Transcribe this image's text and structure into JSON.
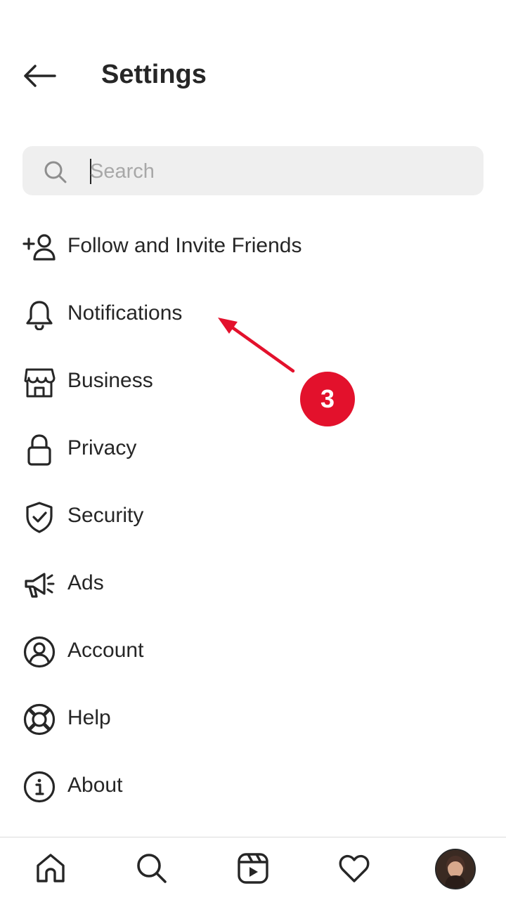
{
  "header": {
    "title": "Settings",
    "back_icon": "arrow-left-icon"
  },
  "search": {
    "placeholder": "Search",
    "value": "",
    "icon": "search-icon"
  },
  "menu": {
    "items": [
      {
        "label": "Follow and Invite Friends",
        "icon": "add-person-icon"
      },
      {
        "label": "Notifications",
        "icon": "bell-icon"
      },
      {
        "label": "Business",
        "icon": "storefront-icon"
      },
      {
        "label": "Privacy",
        "icon": "lock-icon"
      },
      {
        "label": "Security",
        "icon": "shield-check-icon"
      },
      {
        "label": "Ads",
        "icon": "megaphone-icon"
      },
      {
        "label": "Account",
        "icon": "user-circle-icon"
      },
      {
        "label": "Help",
        "icon": "lifebuoy-icon"
      },
      {
        "label": "About",
        "icon": "info-icon"
      }
    ]
  },
  "annotation": {
    "step_number": "3",
    "color": "#e3112c"
  },
  "bottom_nav": {
    "tabs": [
      {
        "icon": "home-icon"
      },
      {
        "icon": "search-icon"
      },
      {
        "icon": "reels-icon"
      },
      {
        "icon": "heart-icon"
      },
      {
        "icon": "profile-avatar"
      }
    ]
  },
  "colors": {
    "text": "#262626",
    "search_bg": "#efefef",
    "placeholder": "#a8a8a8",
    "divider": "#dbdbdb"
  }
}
